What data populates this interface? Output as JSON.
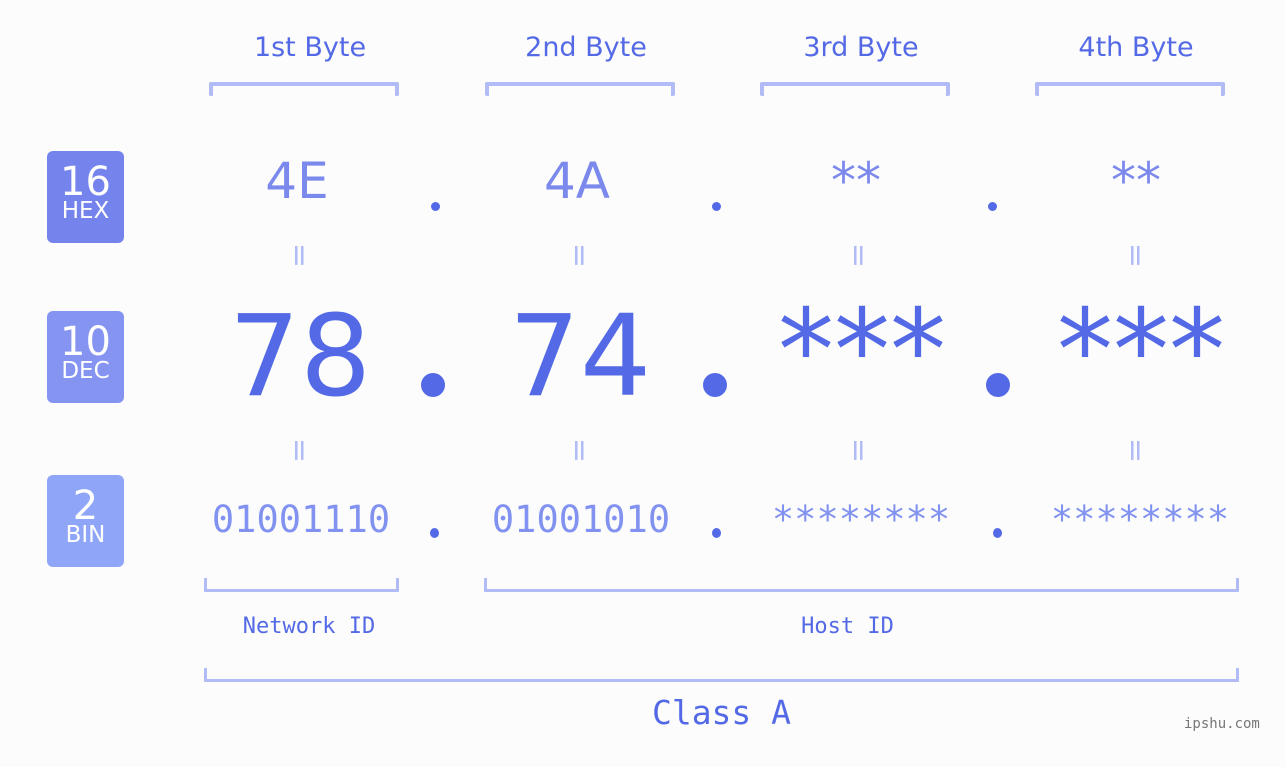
{
  "bytes": [
    {
      "header": "1st Byte",
      "hex": "4E",
      "dec": "78",
      "bin": "01001110"
    },
    {
      "header": "2nd Byte",
      "hex": "4A",
      "dec": "74",
      "bin": "01001010"
    },
    {
      "header": "3rd Byte",
      "hex": "**",
      "dec": "***",
      "bin": "********"
    },
    {
      "header": "4th Byte",
      "hex": "**",
      "dec": "***",
      "bin": "********"
    }
  ],
  "badges": {
    "hex": {
      "num": "16",
      "label": "HEX",
      "color": "#7584ec"
    },
    "dec": {
      "num": "10",
      "label": "DEC",
      "color": "#8594f0"
    },
    "bin": {
      "num": "2",
      "label": "BIN",
      "color": "#8fa5f7"
    }
  },
  "equals_sign": "=",
  "labels": {
    "network_id": "Network ID",
    "host_id": "Host ID",
    "class": "Class A"
  },
  "watermark": "ipshu.com",
  "colors": {
    "accent": "#5469e6",
    "bracket": "#b1bcf6",
    "background": "#fbfcfb"
  }
}
